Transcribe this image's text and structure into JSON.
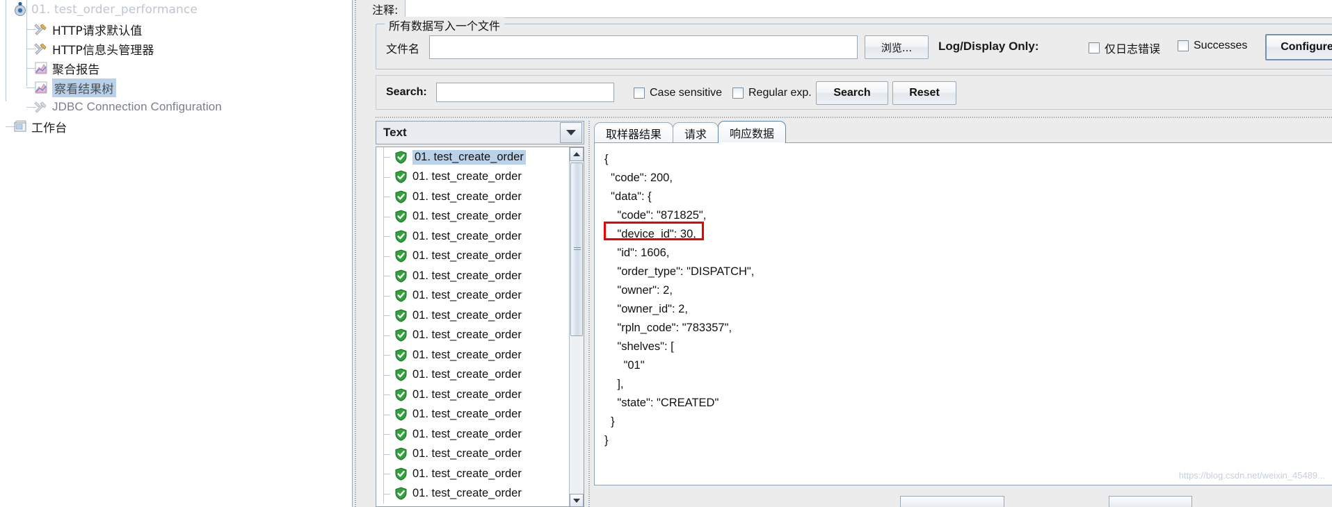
{
  "tree": {
    "items": [
      {
        "label": "01. test_order_performance",
        "icon": "thread-group-icon",
        "state": "cut-off",
        "depth": 1,
        "selected": false
      },
      {
        "label": "HTTP请求默认值",
        "icon": "config-element-icon",
        "depth": 2,
        "selected": false
      },
      {
        "label": "HTTP信息头管理器",
        "icon": "config-element-icon",
        "depth": 2,
        "selected": false
      },
      {
        "label": "聚合报告",
        "icon": "listener-icon",
        "depth": 2,
        "selected": false
      },
      {
        "label": "察看结果树",
        "icon": "listener-icon",
        "depth": 2,
        "selected": true
      },
      {
        "label": "JDBC Connection Configuration",
        "icon": "config-element-icon",
        "depth": 2,
        "selected": false
      },
      {
        "label": "工作台",
        "icon": "workbench-icon",
        "depth": 1,
        "selected": false
      }
    ]
  },
  "panel": {
    "comment_label": "注释:",
    "comment_value": "",
    "group_title": "所有数据写入一个文件",
    "filename_label": "文件名",
    "filename_value": "",
    "filename_placeholder": "",
    "browse_label": "浏览...",
    "log_display_label": "Log/Display Only:",
    "errors_checkbox_label": "仅日志错误",
    "errors_checked": false,
    "successes_checkbox_label": "Successes",
    "successes_checked": false,
    "configure_label": "Configure"
  },
  "search": {
    "label": "Search:",
    "value": "",
    "placeholder": "",
    "case_sensitive_label": "Case sensitive",
    "case_sensitive_checked": false,
    "regular_exp_label": "Regular exp.",
    "regular_exp_checked": false,
    "search_button": "Search",
    "reset_button": "Reset"
  },
  "results": {
    "render_selector": "Text",
    "rows": [
      {
        "label": "01. test_create_order",
        "status": "success",
        "selected": true
      },
      {
        "label": "01. test_create_order",
        "status": "success",
        "selected": false
      },
      {
        "label": "01. test_create_order",
        "status": "success",
        "selected": false
      },
      {
        "label": "01. test_create_order",
        "status": "success",
        "selected": false
      },
      {
        "label": "01. test_create_order",
        "status": "success",
        "selected": false
      },
      {
        "label": "01. test_create_order",
        "status": "success",
        "selected": false
      },
      {
        "label": "01. test_create_order",
        "status": "success",
        "selected": false
      },
      {
        "label": "01. test_create_order",
        "status": "success",
        "selected": false
      },
      {
        "label": "01. test_create_order",
        "status": "success",
        "selected": false
      },
      {
        "label": "01. test_create_order",
        "status": "success",
        "selected": false
      },
      {
        "label": "01. test_create_order",
        "status": "success",
        "selected": false
      },
      {
        "label": "01. test_create_order",
        "status": "success",
        "selected": false
      },
      {
        "label": "01. test_create_order",
        "status": "success",
        "selected": false
      },
      {
        "label": "01. test_create_order",
        "status": "success",
        "selected": false
      },
      {
        "label": "01. test_create_order",
        "status": "success",
        "selected": false
      },
      {
        "label": "01. test_create_order",
        "status": "success",
        "selected": false
      },
      {
        "label": "01. test_create_order",
        "status": "success",
        "selected": false
      },
      {
        "label": "01. test_create_order",
        "status": "success",
        "selected": false
      }
    ]
  },
  "tabs": [
    {
      "label": "取样器结果",
      "active": false
    },
    {
      "label": "请求",
      "active": false
    },
    {
      "label": "响应数据",
      "active": true
    }
  ],
  "response": {
    "lines": [
      "{",
      "  \"code\": 200,",
      "  \"data\": {",
      "    \"code\": \"871825\",",
      "    \"device_id\": 30,",
      "    \"id\": 1606,",
      "    \"order_type\": \"DISPATCH\",",
      "    \"owner\": 2,",
      "    \"owner_id\": 2,",
      "    \"rpln_code\": \"783357\",",
      "    \"shelves\": [",
      "      \"01\"",
      "    ],",
      "    \"state\": \"CREATED\"",
      "  }",
      "}"
    ],
    "highlighted_line_index": 5,
    "highlight_color": "#ee0000",
    "watermark": "https://blog.csdn.net/weixin_45489..."
  }
}
